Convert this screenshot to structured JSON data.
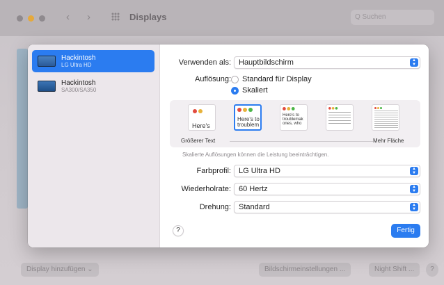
{
  "window": {
    "title": "Displays",
    "search_placeholder": "Q Suchen",
    "back_glyph": "‹",
    "forward_glyph": "›"
  },
  "bottom_bar": {
    "add_display": "Display hinzufügen ⌄",
    "display_settings": "Bildschirmeinstellungen ...",
    "night_shift": "Night Shift ...",
    "help": "?"
  },
  "sidebar": {
    "displays": [
      {
        "name": "Hackintosh",
        "model": "LG Ultra HD",
        "selected": true
      },
      {
        "name": "Hackintosh",
        "model": "SA300/SA350",
        "selected": false
      }
    ]
  },
  "settings": {
    "use_as_label": "Verwenden als:",
    "use_as_value": "Hauptbildschirm",
    "resolution_label": "Auflösung:",
    "resolution_options": [
      {
        "label": "Standard für Display",
        "selected": false
      },
      {
        "label": "Skaliert",
        "selected": true
      }
    ],
    "scale_thumbs": [
      {
        "text": "Here's"
      },
      {
        "text": "Here's to troublem"
      },
      {
        "text": "Here's to troublemak ones, who"
      },
      {
        "text": ""
      },
      {
        "text": ""
      }
    ],
    "scale_left_label": "Größerer Text",
    "scale_right_label": "Mehr Fläche",
    "scale_hint": "Skalierte Auflösungen können die Leistung beeinträchtigen.",
    "color_profile_label": "Farbprofil:",
    "color_profile_value": "LG Ultra HD",
    "refresh_label": "Wiederholrate:",
    "refresh_value": "60 Hertz",
    "rotation_label": "Drehung:",
    "rotation_value": "Standard",
    "help": "?",
    "done": "Fertig"
  },
  "colors": {
    "accent": "#2b7cf0",
    "close": "#e24b3f",
    "minimize": "#e7b23b",
    "zoom": "#4cb548"
  },
  "icons": {
    "display": "monitor-icon",
    "popup": "chevron-updown-icon",
    "radio": "radio-icon"
  }
}
